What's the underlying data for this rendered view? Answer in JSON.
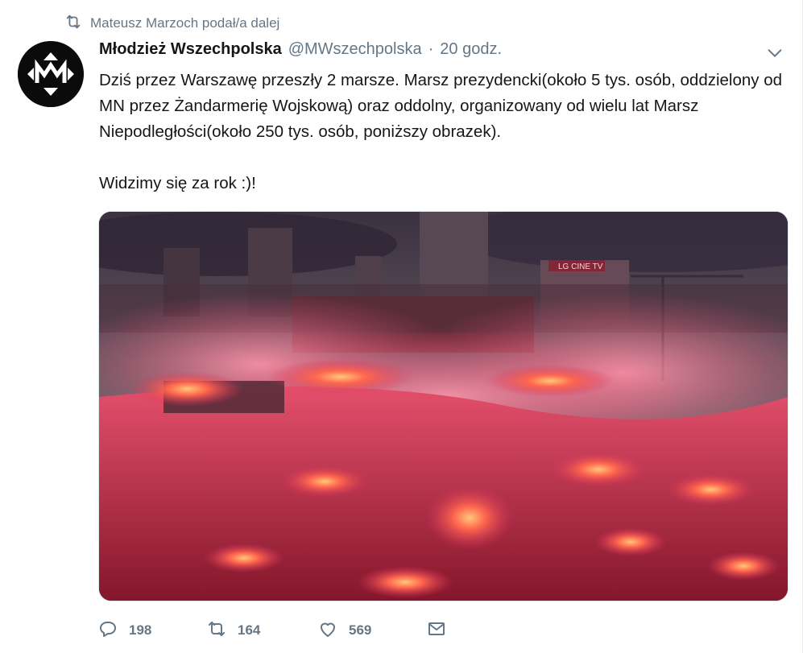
{
  "retweet_context": {
    "icon": "retweet-icon",
    "text": "Mateusz Marzoch podał/a dalej"
  },
  "tweet": {
    "avatar": {
      "icon": "mw-logo",
      "bg_color": "#0b0b0b"
    },
    "display_name": "Młodzież Wszechpolska",
    "handle": "@MWszechpolska",
    "separator": "·",
    "timestamp": "20 godz.",
    "caret_icon": "chevron-down-icon",
    "text_paragraph_1": "Dziś przez Warszawę przeszły 2 marsze. Marsz prezydencki(około 5 tys. osób, oddzielony od MN przez Żandarmerię Wojskową) oraz oddolny, organizowany od wielu lat Marsz Niepodległości(około 250 tys. osób, poniższy obrazek).",
    "text_paragraph_2": "Widzimy się za rok :)!",
    "media": {
      "description_icon": "photo",
      "billboard_text": "LG CINE TV"
    }
  },
  "actions": {
    "reply": {
      "icon": "reply-icon",
      "count": "198"
    },
    "retweet": {
      "icon": "retweet-icon",
      "count": "164"
    },
    "like": {
      "icon": "heart-icon",
      "count": "569"
    },
    "dm": {
      "icon": "envelope-icon"
    }
  },
  "colors": {
    "secondary_text": "#657786",
    "primary_text": "#14171a",
    "border": "#e1e8ed"
  }
}
